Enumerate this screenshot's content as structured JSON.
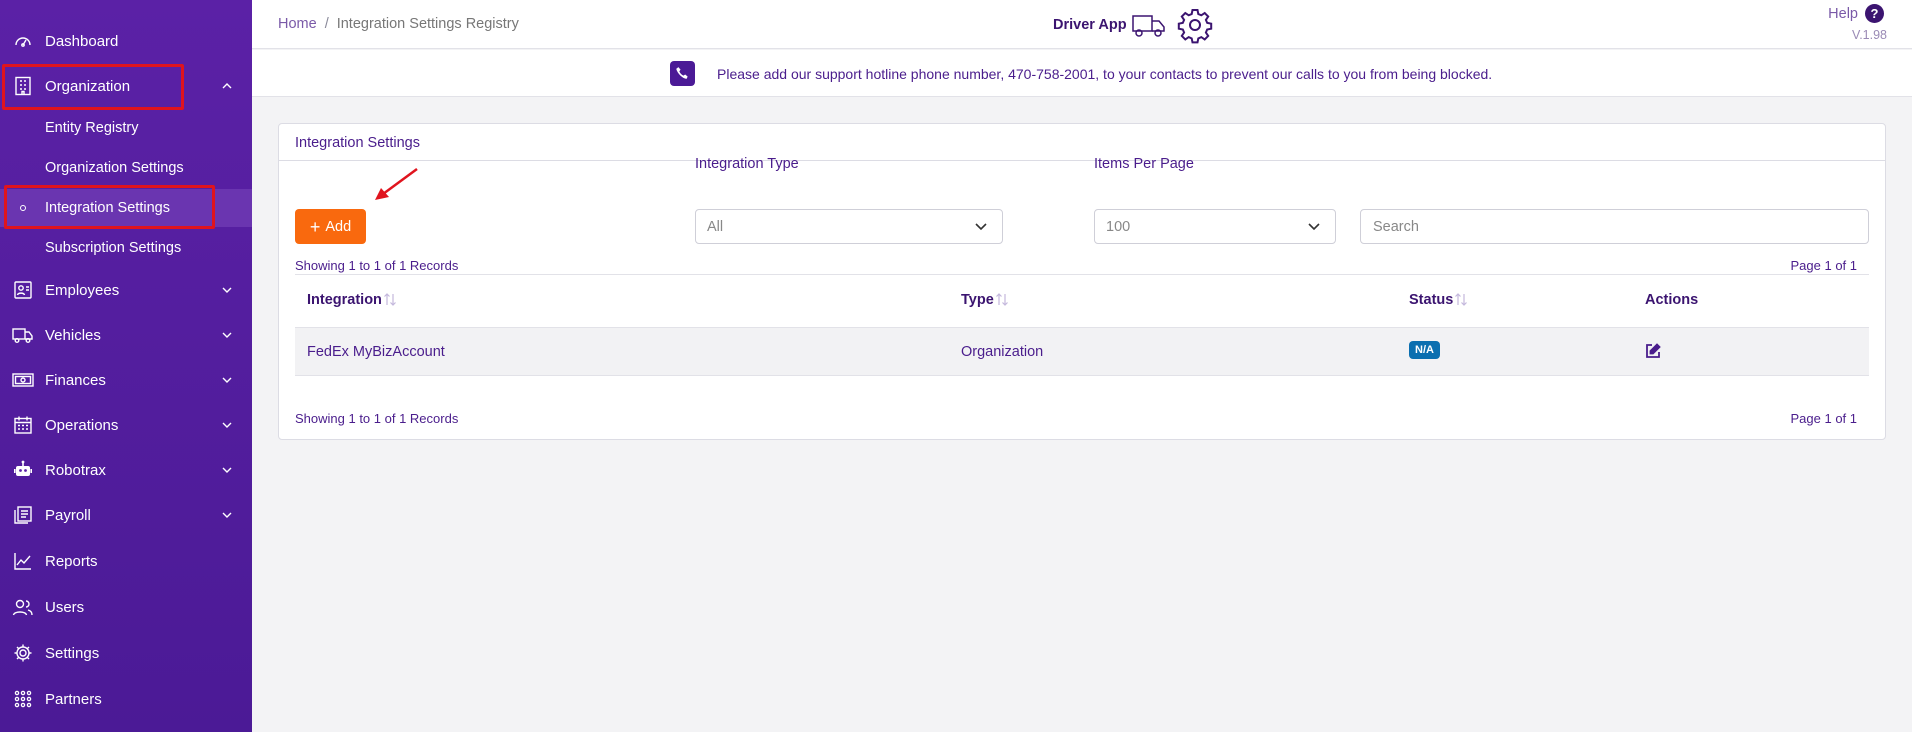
{
  "sidebar": {
    "dashboard": "Dashboard",
    "organization": "Organization",
    "sub_items": [
      "Entity Registry",
      "Organization Settings",
      "Integration Settings",
      "Subscription Settings"
    ],
    "employees": "Employees",
    "vehicles": "Vehicles",
    "finances": "Finances",
    "operations": "Operations",
    "robotrax": "Robotrax",
    "payroll": "Payroll",
    "reports": "Reports",
    "users": "Users",
    "settings": "Settings",
    "partners": "Partners"
  },
  "header": {
    "breadcrumb_home": "Home",
    "breadcrumb_sep": "/",
    "breadcrumb_current": "Integration Settings Registry",
    "driver_app": "Driver App",
    "help": "Help",
    "help_icon": "?",
    "version": "V.1.98"
  },
  "notice": {
    "message": "Please add our support hotline phone number, 470-758-2001, to your contacts to prevent our calls to you from being blocked."
  },
  "card": {
    "title": "Integration Settings",
    "add_label": "Add",
    "integration_type_label": "Integration Type",
    "integration_type_value": "All",
    "items_per_page_label": "Items Per Page",
    "items_per_page_value": "100",
    "search_placeholder": "Search",
    "records_text": "Showing 1 to 1 of 1 Records",
    "page_text": "Page 1 of 1"
  },
  "table": {
    "columns": [
      "Integration",
      "Type",
      "Status",
      "Actions"
    ],
    "rows": [
      {
        "integration": "FedEx MyBizAccount",
        "type": "Organization",
        "status": "N/A"
      }
    ]
  },
  "colors": {
    "sidebar": "#5b21a6",
    "accent": "#f9690e",
    "badge": "#0b6fb0",
    "highlight": "#e0141e"
  }
}
